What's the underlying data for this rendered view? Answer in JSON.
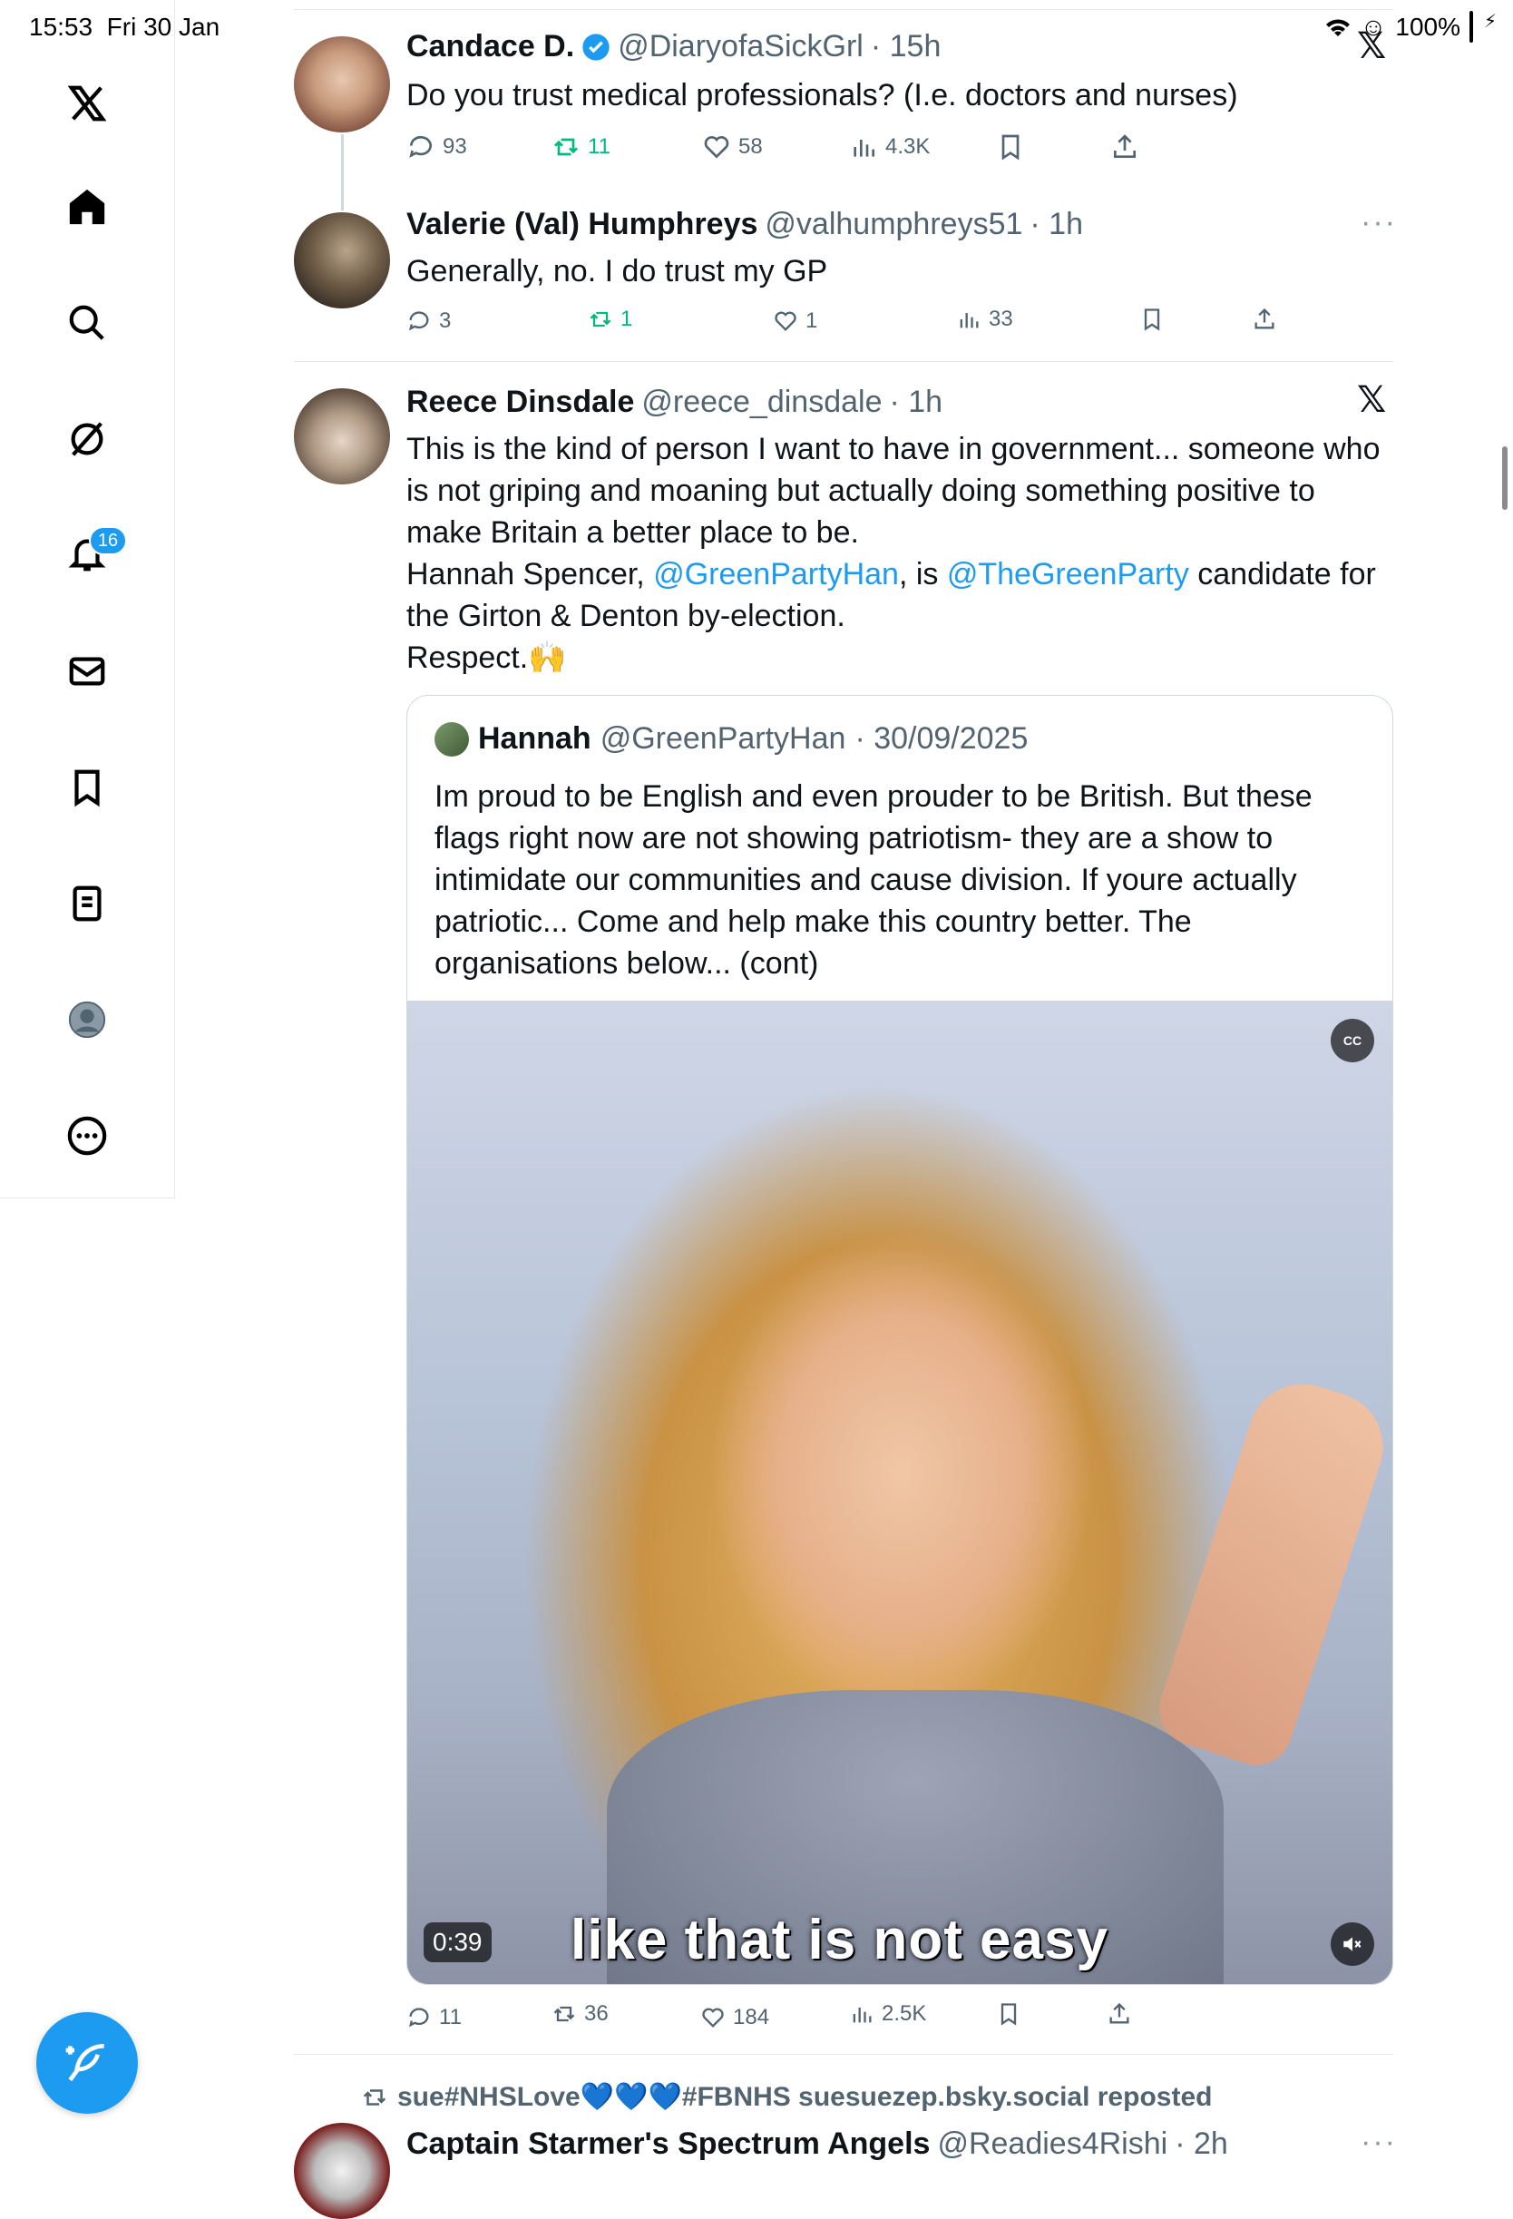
{
  "status_bar": {
    "time": "15:53",
    "date": "Fri 30 Jan",
    "battery": "100%"
  },
  "sidebar": {
    "items": [
      {
        "icon": "x-logo-icon"
      },
      {
        "icon": "home-icon"
      },
      {
        "icon": "search-icon"
      },
      {
        "icon": "grok-icon"
      },
      {
        "icon": "bell-icon"
      },
      {
        "icon": "mail-icon"
      },
      {
        "icon": "bookmark-icon"
      },
      {
        "icon": "list-icon"
      },
      {
        "icon": "profile-icon"
      },
      {
        "icon": "more-circle-icon"
      }
    ],
    "notification_badge": "16"
  },
  "tweets": [
    {
      "name": "Candace D.",
      "handle": "@DiaryofaSickGrl",
      "time": "· 15h",
      "text": "Do you trust medical professionals? (I.e. doctors and nurses)",
      "replies": "93",
      "reposts": "11",
      "likes": "58",
      "views": "4.3K"
    },
    {
      "name": "Valerie (Val) Humphreys",
      "handle": "@valhumphreys51",
      "time": "· 1h",
      "text": "Generally, no. I do trust my GP",
      "replies": "3",
      "reposts": "1",
      "likes": "1",
      "views": "33"
    },
    {
      "name": "Reece Dinsdale",
      "handle": "@reece_dinsdale",
      "time": "· 1h",
      "text_line1": "This is the kind of person I want to have in government... someone who is not griping and moaning but actually doing something positive to make Britain a better place to be.",
      "text_line2_pre": "Hannah Spencer, ",
      "text_line2_mention1": "@GreenPartyHan",
      "text_line2_mid": ", is ",
      "text_line2_mention2": "@TheGreenParty",
      "text_line2_post": " candidate for the Girton & Denton by-election.",
      "text_line3": "Respect.🙌",
      "replies": "11",
      "reposts": "36",
      "likes": "184",
      "views": "2.5K",
      "quote": {
        "name": "Hannah",
        "handle": "@GreenPartyHan",
        "time": "· 30/09/2025",
        "text": "Im proud to be English and even prouder to be British. But these flags right now are not showing patriotism- they are a show to intimidate our communities and cause division. If youre actually patriotic... Come and help make this country better. The organisations below... (cont)",
        "video_duration": "0:39",
        "video_caption": "like that is not easy",
        "cc_label": "CC"
      }
    },
    {
      "repost_by": "sue#NHSLove💙💙💙#FBNHS suesuezep.bsky.social reposted",
      "name": "Captain Starmer's Spectrum Angels",
      "handle": "@Readies4Rishi",
      "time": "· 2h"
    }
  ],
  "more_label": "···",
  "x_label": "𝕏"
}
